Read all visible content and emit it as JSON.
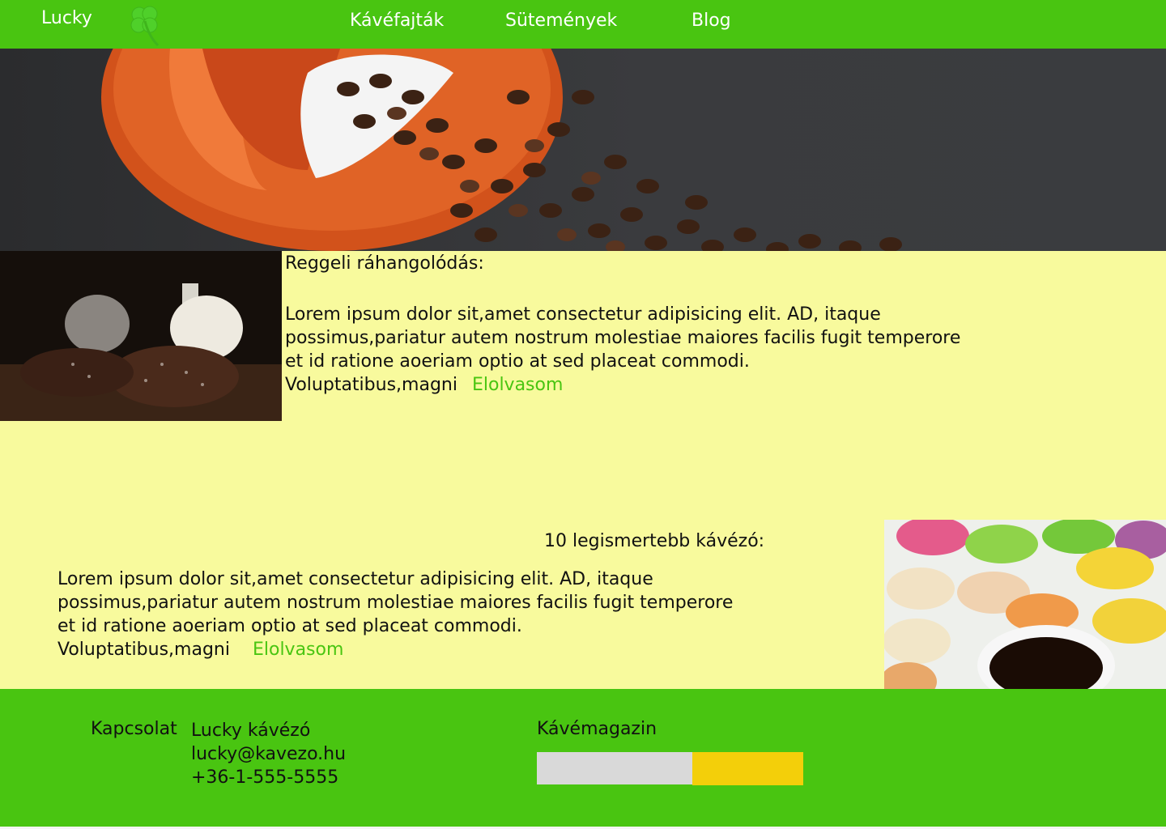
{
  "header": {
    "brand": "Lucky",
    "nav": [
      {
        "label": "Kávéfajták"
      },
      {
        "label": "Sütemények"
      },
      {
        "label": "Blog"
      }
    ]
  },
  "articles": [
    {
      "title": "Reggeli ráhangolódás:",
      "lines": [
        "Lorem ipsum dolor sit,amet consectetur adipisicing elit. AD, itaque",
        "possimus,pariatur autem nostrum molestiae maiores facilis fugit temperore",
        "et id ratione aoeriam optio at sed placeat commodi.",
        "Voluptatibus,magni"
      ],
      "link": "Elolvasom"
    },
    {
      "title": "10 legismertebb kávézó:",
      "lines": [
        "Lorem ipsum dolor sit,amet consectetur adipisicing elit. AD, itaque",
        "possimus,pariatur autem nostrum molestiae maiores facilis fugit temperore",
        "et id ratione aoeriam optio at sed placeat commodi.",
        "Voluptatibus,magni"
      ],
      "link": "Elolvasom"
    }
  ],
  "footer": {
    "contact_label": "Kapcsolat",
    "contact_lines": [
      "Lucky kávézó",
      "lucky@kavezo.hu",
      "+36-1-555-5555"
    ],
    "newsletter_label": "Kávémagazin",
    "newsletter_input_value": "",
    "newsletter_button_label": ""
  },
  "icons": {
    "logo": "clover-icon"
  },
  "colors": {
    "primary_green": "#49c511",
    "content_background": "#f8fa9d",
    "link_green": "#49c511",
    "button_yellow": "#f3cf0a",
    "input_gray": "#d9d9d9"
  }
}
